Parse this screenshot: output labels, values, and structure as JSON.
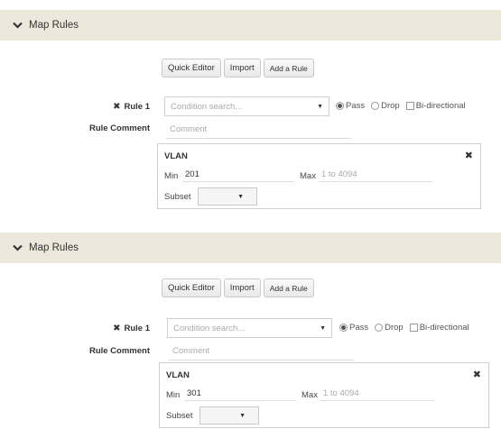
{
  "sections": [
    {
      "header": {
        "title": "Map Rules"
      },
      "toolbar": {
        "quick_editor": "Quick Editor",
        "import": "Import",
        "add_rule": "Add a Rule"
      },
      "rule": {
        "label": "Rule 1",
        "comment_label": "Rule Comment",
        "condition_placeholder": "Condition search...",
        "pass": "Pass",
        "drop": "Drop",
        "bidirectional": "Bi-directional",
        "selected_action": "Pass",
        "bidirectional_checked": false,
        "comment_placeholder": "Comment"
      },
      "condition": {
        "title": "VLAN",
        "min_label": "Min",
        "min_value": "201",
        "max_label": "Max",
        "max_placeholder": "1 to 4094",
        "subset_label": "Subset",
        "subset_value": ""
      }
    },
    {
      "header": {
        "title": "Map Rules"
      },
      "toolbar": {
        "quick_editor": "Quick Editor",
        "import": "Import",
        "add_rule": "Add a Rule"
      },
      "rule": {
        "label": "Rule 1",
        "comment_label": "Rule Comment",
        "condition_placeholder": "Condition search...",
        "pass": "Pass",
        "drop": "Drop",
        "bidirectional": "Bi-directional",
        "selected_action": "Pass",
        "bidirectional_checked": false,
        "comment_placeholder": "Comment"
      },
      "condition": {
        "title": "VLAN",
        "min_label": "Min",
        "min_value": "301",
        "max_label": "Max",
        "max_placeholder": "1 to 4094",
        "subset_label": "Subset",
        "subset_value": ""
      }
    }
  ],
  "colors": {
    "header_bg": "#ece9dc",
    "border": "#cfcfcf",
    "placeholder": "#aaaaaa"
  },
  "icons": {
    "collapse": "chevron-down-icon",
    "remove_rule": "close-icon",
    "remove_condition": "close-icon",
    "dropdown": "caret-down-icon"
  }
}
